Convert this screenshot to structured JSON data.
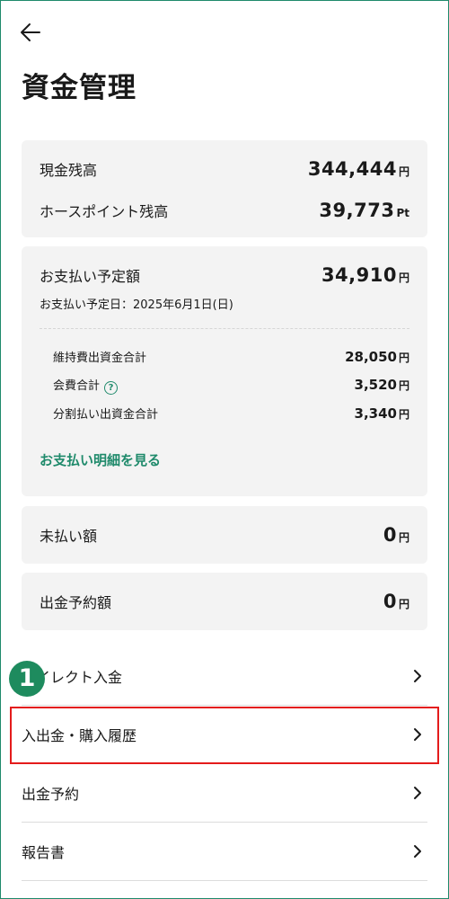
{
  "header": {
    "title": "資金管理"
  },
  "balances": {
    "cash": {
      "label": "現金残高",
      "amount": "344,444",
      "unit": "円"
    },
    "points": {
      "label": "ホースポイント残高",
      "amount": "39,773",
      "unit": "Pt"
    }
  },
  "payment": {
    "label": "お支払い予定額",
    "amount": "34,910",
    "unit": "円",
    "date_text": "お支払い予定日：2025年6月1日(日)",
    "items": [
      {
        "label": "維持費出資金合計",
        "amount": "28,050",
        "unit": "円"
      },
      {
        "label": "会費合計",
        "amount": "3,520",
        "unit": "円"
      },
      {
        "label": "分割払い出資金合計",
        "amount": "3,340",
        "unit": "円"
      }
    ],
    "help_icon_glyph": "?",
    "detail_link": "お支払い明細を見る"
  },
  "unpaid": {
    "label": "未払い額",
    "amount": "0",
    "unit": "円"
  },
  "withdraw_reserved": {
    "label": "出金予約額",
    "amount": "0",
    "unit": "円"
  },
  "menu": [
    {
      "label": "ダイレクト入金"
    },
    {
      "label": "入出金・購入履歴"
    },
    {
      "label": "出金予約"
    },
    {
      "label": "報告書"
    }
  ],
  "annotation": {
    "step_number": "1"
  },
  "colors": {
    "accent": "#1f8a6b",
    "highlight": "#e41b1b",
    "card_bg": "#f3f3f3"
  }
}
